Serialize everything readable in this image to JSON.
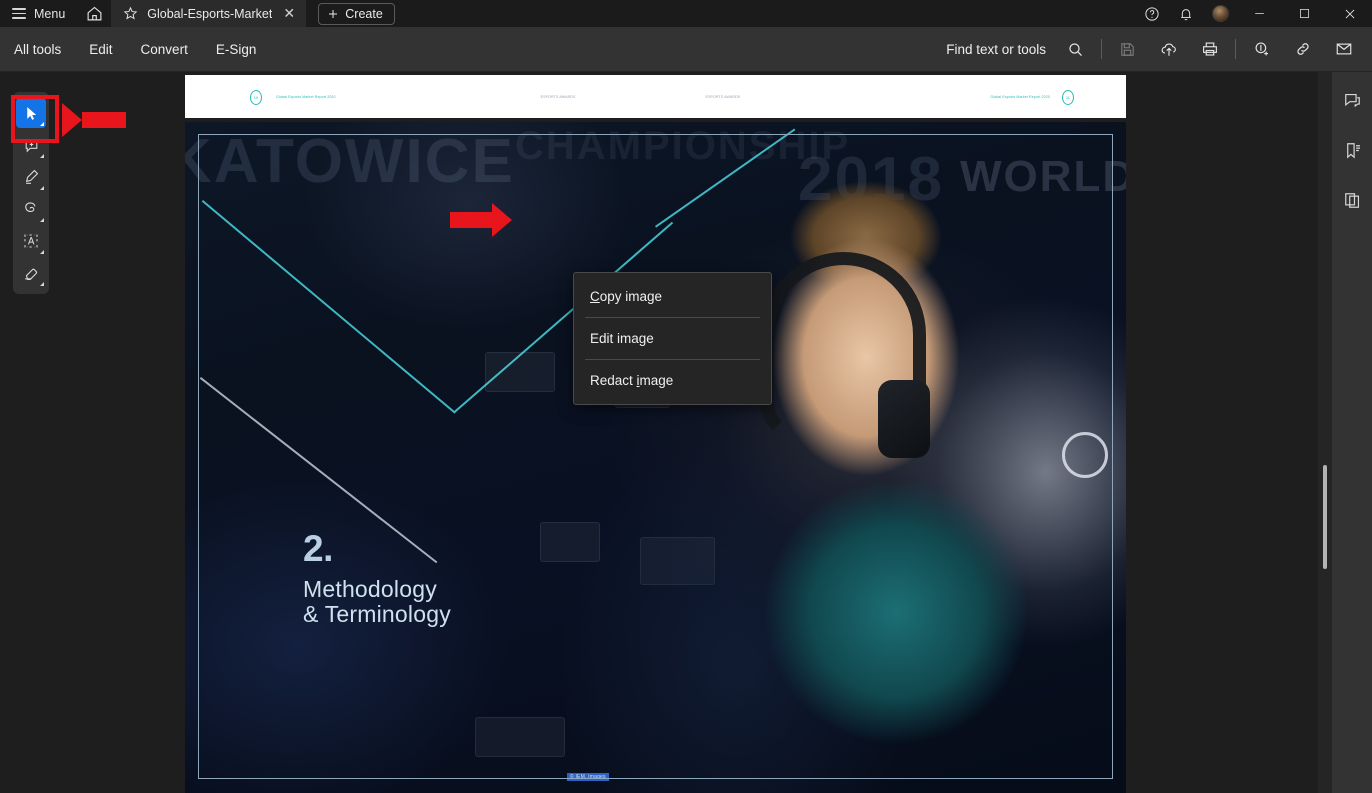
{
  "app": {
    "menu_label": "Menu",
    "home_icon": "home-icon",
    "hamburger_icon": "hamburger-icon"
  },
  "tab": {
    "star_icon": "star-icon",
    "title": "Global-Esports-Market-…",
    "close_icon": "close-icon"
  },
  "create_button": {
    "label": "Create",
    "icon": "plus-icon"
  },
  "titlebar_right": {
    "help_icon": "help-circle-icon",
    "notifications_icon": "bell-icon",
    "avatar": "user-avatar",
    "minimize_icon": "minimize-icon",
    "maximize_icon": "maximize-icon",
    "close_icon": "window-close-icon"
  },
  "menubar": {
    "items": [
      {
        "label": "All tools"
      },
      {
        "label": "Edit"
      },
      {
        "label": "Convert"
      },
      {
        "label": "E-Sign"
      }
    ],
    "find": {
      "label": "Find text or tools",
      "icon": "search-icon"
    },
    "actions": [
      {
        "name": "save-icon",
        "enabled": false
      },
      {
        "name": "upload-cloud-icon",
        "enabled": true
      },
      {
        "name": "print-icon",
        "enabled": true
      },
      {
        "name": "add-signature-icon",
        "enabled": true
      },
      {
        "name": "link-icon",
        "enabled": true
      },
      {
        "name": "email-icon",
        "enabled": true
      }
    ]
  },
  "left_tools": [
    {
      "name": "select-tool",
      "icon": "cursor-arrow-icon",
      "active": true
    },
    {
      "name": "add-comment-tool",
      "icon": "comment-plus-icon",
      "active": false
    },
    {
      "name": "highlight-tool",
      "icon": "highlighter-icon",
      "active": false
    },
    {
      "name": "draw-tool",
      "icon": "freehand-scribble-icon",
      "active": false
    },
    {
      "name": "text-select-tool",
      "icon": "text-box-icon",
      "active": false
    },
    {
      "name": "erase-tool",
      "icon": "eraser-icon",
      "active": false
    }
  ],
  "right_panels": [
    {
      "name": "comments-panel",
      "icon": "comment-icon"
    },
    {
      "name": "bookmarks-panel",
      "icon": "bookmark-icon"
    },
    {
      "name": "page-thumbnails-panel",
      "icon": "pages-icon"
    }
  ],
  "context_menu": {
    "items": [
      {
        "label": "Copy image",
        "mnemonic_index": 0
      },
      {
        "label": "Edit image",
        "mnemonic_index": 6
      },
      {
        "label": "Redact image",
        "mnemonic_index": 7
      }
    ]
  },
  "document": {
    "page_header": {
      "left_page_number": "10",
      "left_text": "Global Esports Market Report 2020",
      "center_text_1": "ESPORTS AWARDS",
      "center_text_2": "ESPORTS AWARDS",
      "right_text": "Global Esports Market Report 2020",
      "right_page_number": "11"
    },
    "slide": {
      "section_number": "2.",
      "section_title": "Methodology\n& Terminology",
      "background_words": {
        "katowice": "KATOWICE",
        "championship": "CHAMPIONSHIP",
        "year": "2018",
        "world_championship": "WORLD C"
      },
      "caption": "© IEM, Images"
    }
  },
  "annotations": {
    "tool_highlight_color": "#e8151d",
    "arrow_to_select_tool": "red-arrow-left",
    "arrow_to_context_menu": "red-arrow-right"
  },
  "scrollbar": {
    "name": "vertical-scrollbar"
  }
}
